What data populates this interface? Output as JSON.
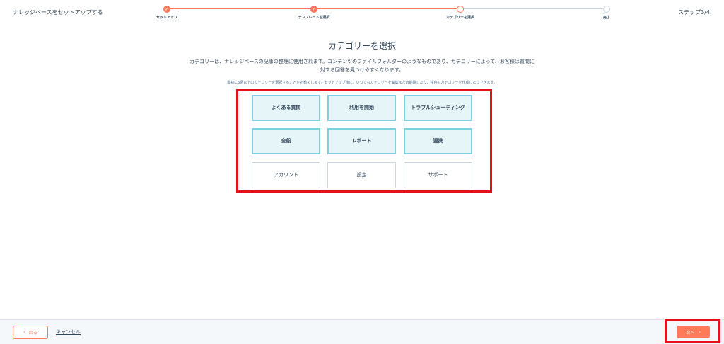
{
  "header": {
    "app_title": "ナレッジベースをセットアップする",
    "step_count": "ステップ3/4"
  },
  "steps": [
    {
      "label": "セットアップ",
      "status": "done"
    },
    {
      "label": "テンプレートを選択",
      "status": "done"
    },
    {
      "label": "カテゴリーを選択",
      "status": "current"
    },
    {
      "label": "完了",
      "status": "todo"
    }
  ],
  "main": {
    "heading": "カテゴリーを選択",
    "description": "カテゴリーは、ナレッジベースの記事の整理に使用されます。コンテンツのファイルフォルダーのようなものであり、カテゴリーによって、お客様は質問に対する回答を見つけやすくなります。",
    "hint": "最初に6個以上のカテゴリーを選択することをお勧めします。セットアップ後に、いつでもカテゴリーを編集または削除したり、独自のカテゴリーを作成したりできます。"
  },
  "categories": [
    {
      "label": "よくある質問",
      "selected": true
    },
    {
      "label": "利用を開始",
      "selected": true
    },
    {
      "label": "トラブルシューティング",
      "selected": true
    },
    {
      "label": "全般",
      "selected": true
    },
    {
      "label": "レポート",
      "selected": true
    },
    {
      "label": "連携",
      "selected": true
    },
    {
      "label": "アカウント",
      "selected": false
    },
    {
      "label": "設定",
      "selected": false
    },
    {
      "label": "サポート",
      "selected": false
    }
  ],
  "footer": {
    "back_label": "戻る",
    "back_icon": "chevron-left-icon",
    "cancel_label": "キャンセル",
    "next_label": "次へ",
    "next_icon": "chevron-right-icon"
  },
  "colors": {
    "accent": "#ff7a59",
    "selected_bg": "#e5f5f8",
    "selected_border": "#7fd1de",
    "highlight": "#e4101a"
  }
}
